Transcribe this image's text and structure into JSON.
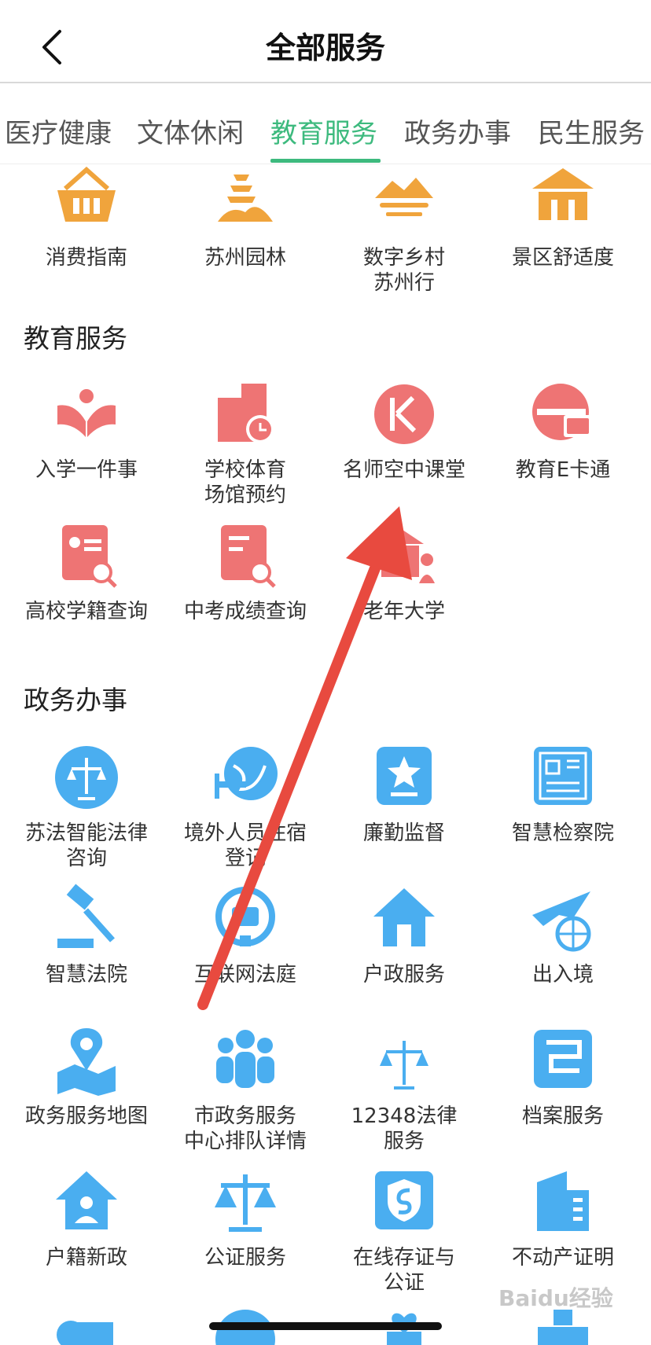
{
  "header": {
    "title": "全部服务"
  },
  "tabs": [
    {
      "label": "医疗健康"
    },
    {
      "label": "文体休闲"
    },
    {
      "label": "教育服务"
    },
    {
      "label": "政务办事"
    },
    {
      "label": "民生服务"
    }
  ],
  "culture_items": [
    {
      "label": "消费指南"
    },
    {
      "label": "苏州园林"
    },
    {
      "label": "数字乡村\n苏州行"
    },
    {
      "label": "景区舒适度"
    }
  ],
  "education": {
    "title": "教育服务",
    "items": [
      {
        "label": "入学一件事"
      },
      {
        "label": "学校体育\n场馆预约"
      },
      {
        "label": "名师空中课堂"
      },
      {
        "label": "教育E卡通"
      },
      {
        "label": "高校学籍查询"
      },
      {
        "label": "中考成绩查询"
      },
      {
        "label": "老年大学"
      }
    ]
  },
  "government": {
    "title": "政务办事",
    "items": [
      {
        "label": "苏法智能法律\n咨询"
      },
      {
        "label": "境外人员住宿\n登记"
      },
      {
        "label": "廉勤监督"
      },
      {
        "label": "智慧检察院"
      },
      {
        "label": "智慧法院"
      },
      {
        "label": "互联网法庭"
      },
      {
        "label": "户政服务"
      },
      {
        "label": "出入境"
      },
      {
        "label": "政务服务地图"
      },
      {
        "label": "市政务服务\n中心排队详情"
      },
      {
        "label": "12348法律\n服务"
      },
      {
        "label": "档案服务"
      },
      {
        "label": "户籍新政"
      },
      {
        "label": "公证服务"
      },
      {
        "label": "在线存证与\n公证"
      },
      {
        "label": "不动产证明"
      }
    ]
  },
  "colors": {
    "accent": "#3dba7e",
    "culture": "#f0a43c",
    "education": "#ee7474",
    "government": "#4aaef0",
    "arrow": "#e84a3f"
  },
  "watermark": "Baidu经验"
}
